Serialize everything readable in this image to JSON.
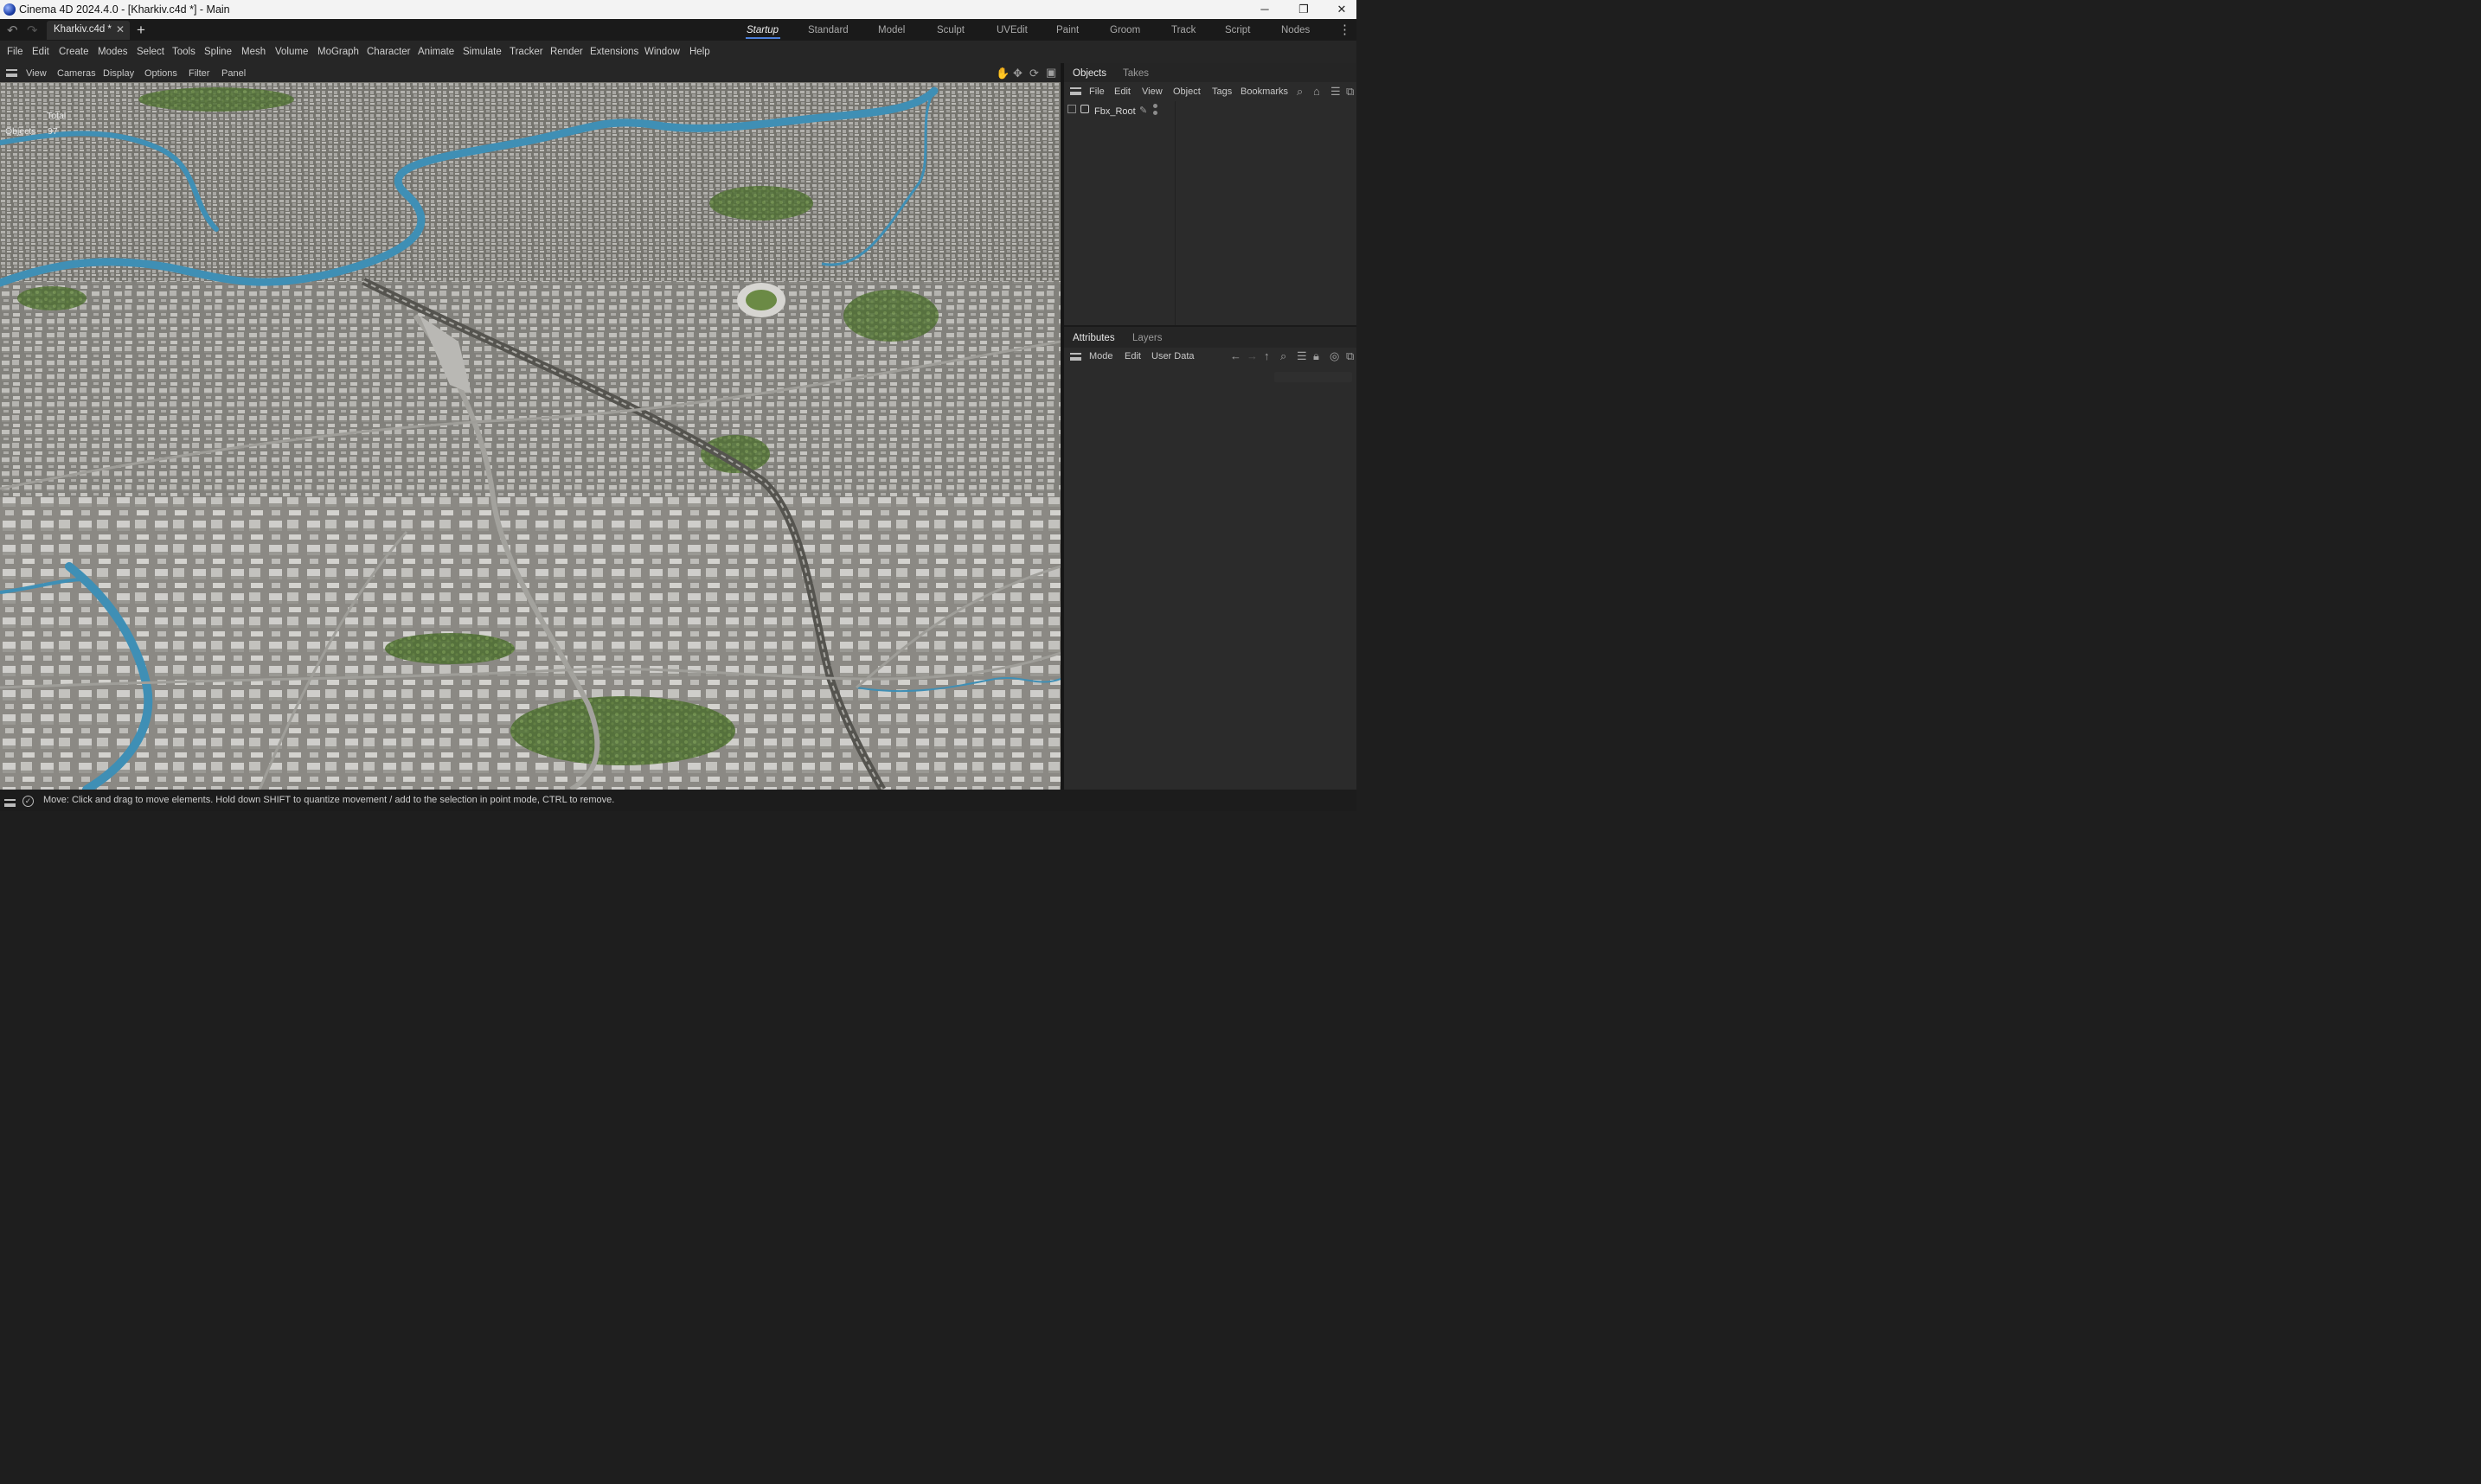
{
  "window": {
    "title": "Cinema 4D 2024.4.0 - [Kharkiv.c4d *] - Main",
    "minimize_glyph": "─",
    "restore_glyph": "❐",
    "close_glyph": "✕"
  },
  "tabbar": {
    "document_tab": "Kharkiv.c4d *",
    "close_glyph": "✕",
    "add_glyph": "+",
    "undo_glyph": "↶",
    "redo_glyph": "↷",
    "more_glyph": "⋮",
    "layouts": [
      "Startup",
      "Standard",
      "Model",
      "Sculpt",
      "UVEdit",
      "Paint",
      "Groom",
      "Track",
      "Script",
      "Nodes"
    ],
    "active_layout": "Startup"
  },
  "menubar": {
    "items": [
      "File",
      "Edit",
      "Create",
      "Modes",
      "Select",
      "Tools",
      "Spline",
      "Mesh",
      "Volume",
      "MoGraph",
      "Character",
      "Animate",
      "Simulate",
      "Tracker",
      "Render",
      "Extensions",
      "Window",
      "Help"
    ]
  },
  "viewport": {
    "menu": [
      "View",
      "Cameras",
      "Display",
      "Options",
      "Filter",
      "Panel"
    ],
    "hud": {
      "total_label": "Total",
      "objects_label": "Objects",
      "objects_value": "97"
    }
  },
  "objects_panel": {
    "tabs": [
      "Objects",
      "Takes"
    ],
    "menu": [
      "File",
      "Edit",
      "View",
      "Object",
      "Tags",
      "Bookmarks"
    ],
    "tree": [
      {
        "name": "Fbx_Root"
      }
    ]
  },
  "attributes_panel": {
    "tabs": [
      "Attributes",
      "Layers"
    ],
    "menu": [
      "Mode",
      "Edit",
      "User Data"
    ]
  },
  "statusbar": {
    "text": "Move: Click and drag to move elements. Hold down SHIFT to quantize movement / add to the selection in point mode, CTRL to remove."
  },
  "colors": {
    "accent": "#4c7fd9",
    "river": "#3f8fb5",
    "ground": "#8a8883",
    "building": "#bdbdbb",
    "park": "#5a7a3c"
  }
}
